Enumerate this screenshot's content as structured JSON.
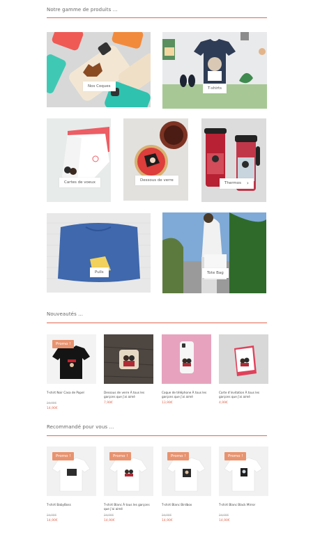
{
  "sections": {
    "range_title": "Notre gamme de produits ...",
    "new_title": "Nouveautés ...",
    "recommended_title": "Recommandé pour vous ..."
  },
  "categories": [
    {
      "label": "Nos Coques"
    },
    {
      "label": "T-shirts"
    },
    {
      "label": "Cartes de voeux"
    },
    {
      "label": "Dessous de verre"
    },
    {
      "label": "Thermos",
      "arrow": "›"
    },
    {
      "label": "Pulls"
    },
    {
      "label": "Tote Bag"
    }
  ],
  "new_products": [
    {
      "name": "T-shirt Noir Casa de Papel",
      "old_price": "24,90€",
      "price": "14,90€",
      "promo": "Promo !"
    },
    {
      "name": "Dessous de verre À tous les garçons que j'ai aimé",
      "price": "7,99€"
    },
    {
      "name": "Coque de téléphone À tous les garçons que j'ai aimé",
      "price": "13,99€"
    },
    {
      "name": "Carte d'invitation À tous les garçons que j'ai aimé",
      "price": "4,99€"
    }
  ],
  "recommended_products": [
    {
      "name": "T-shirt BabyBoss",
      "old_price": "24,90€",
      "price": "14,90€",
      "promo": "Promo !"
    },
    {
      "name": "T-shirt Blanc À tous les garçons que j'ai aimé",
      "old_price": "24,90€",
      "price": "14,90€",
      "promo": "Promo !"
    },
    {
      "name": "T-shirt Blanc Birdbox",
      "old_price": "24,90€",
      "price": "14,90€",
      "promo": "Promo !"
    },
    {
      "name": "T-shirt Blanc Black Mirror",
      "old_price": "24,90€",
      "price": "14,90€",
      "promo": "Promo !"
    }
  ],
  "colors": {
    "accent": "#e2674f",
    "promo": "#e8936f"
  }
}
